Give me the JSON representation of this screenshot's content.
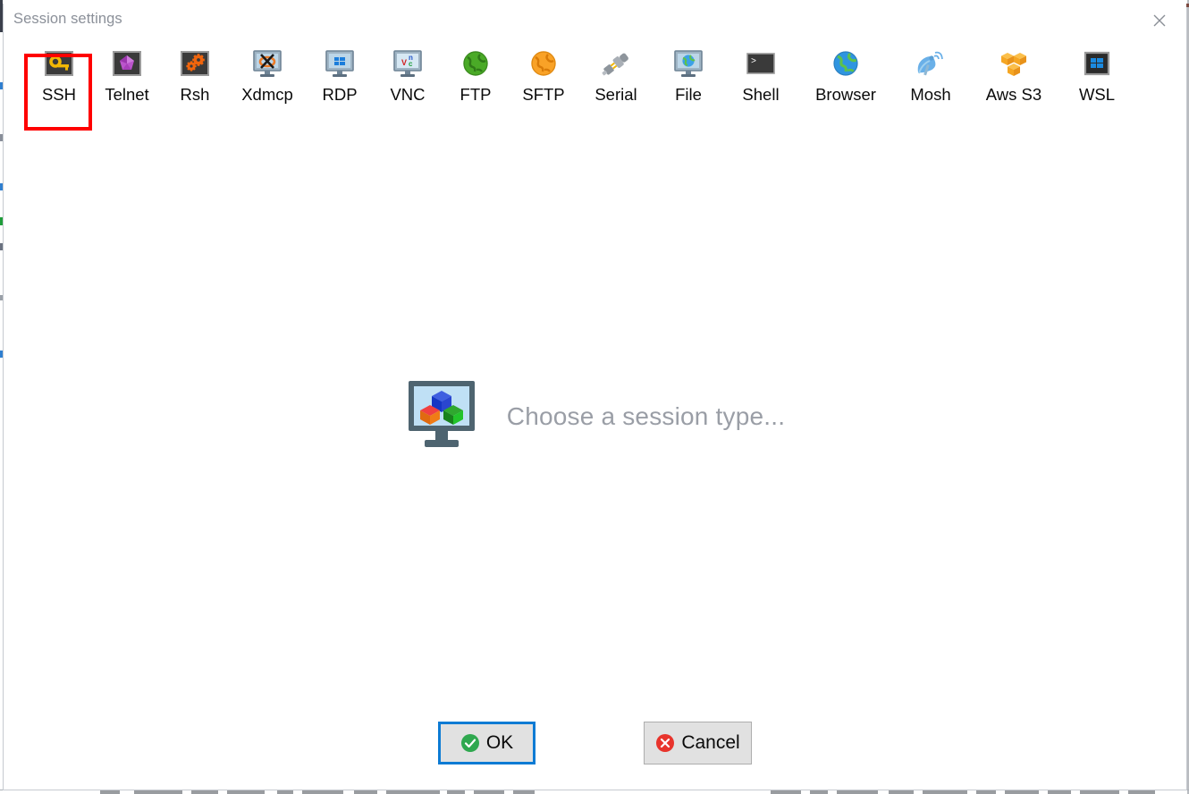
{
  "window": {
    "title": "Session settings",
    "close_icon": "close-x-icon",
    "accent_color": "#7d4a41",
    "title_color": "#8b9099"
  },
  "session_types": [
    {
      "label": "SSH",
      "icon": "key-icon",
      "selected": true
    },
    {
      "label": "Telnet",
      "icon": "purple-gem-icon",
      "selected": false
    },
    {
      "label": "Rsh",
      "icon": "orange-gears-icon",
      "selected": false
    },
    {
      "label": "Xdmcp",
      "icon": "x-window-monitor-icon",
      "selected": false
    },
    {
      "label": "RDP",
      "icon": "windows-monitor-icon",
      "selected": false
    },
    {
      "label": "VNC",
      "icon": "vnc-monitor-icon",
      "selected": false
    },
    {
      "label": "FTP",
      "icon": "green-globe-icon",
      "selected": false
    },
    {
      "label": "SFTP",
      "icon": "orange-globe-icon",
      "selected": false
    },
    {
      "label": "Serial",
      "icon": "serial-plug-icon",
      "selected": false
    },
    {
      "label": "File",
      "icon": "globe-monitor-icon",
      "selected": false
    },
    {
      "label": "Shell",
      "icon": "terminal-prompt-icon",
      "selected": false
    },
    {
      "label": "Browser",
      "icon": "blue-globe-icon",
      "selected": false
    },
    {
      "label": "Mosh",
      "icon": "satellite-dish-icon",
      "selected": false
    },
    {
      "label": "Aws S3",
      "icon": "aws-cubes-icon",
      "selected": false
    },
    {
      "label": "WSL",
      "icon": "windows-logo-icon",
      "selected": false
    }
  ],
  "selection_highlight": {
    "target": "SSH",
    "color": "#ff0000"
  },
  "main": {
    "placeholder_text": "Choose a session type...",
    "placeholder_icon": "monitor-cubes-icon",
    "placeholder_text_color": "#9a9ea6"
  },
  "buttons": {
    "ok": {
      "label": "OK",
      "icon": "green-check-icon",
      "focused": true,
      "focus_color": "#0d7bd4"
    },
    "cancel": {
      "label": "Cancel",
      "icon": "red-x-icon",
      "focused": false
    }
  }
}
